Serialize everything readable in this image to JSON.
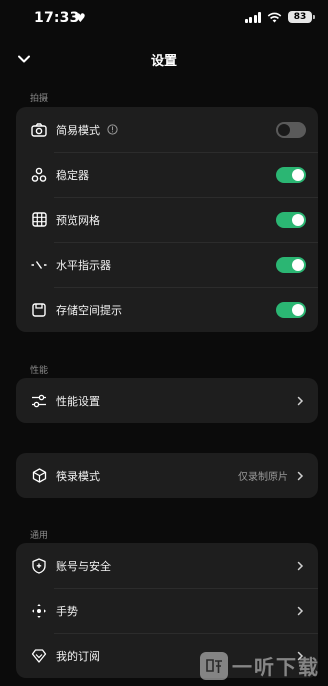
{
  "status_bar": {
    "time": "17:33",
    "heart_icon": "heart-icon",
    "battery": "83"
  },
  "nav": {
    "title": "设置",
    "back_icon": "chevron-down-icon"
  },
  "sections": {
    "shooting": {
      "label": "拍摄",
      "items": [
        {
          "label": "简易模式",
          "icon": "camera-icon",
          "info_icon": "info-icon",
          "toggle": "off"
        },
        {
          "label": "稳定器",
          "icon": "stabilizer-icon",
          "toggle": "on"
        },
        {
          "label": "预览网格",
          "icon": "grid-icon",
          "toggle": "on"
        },
        {
          "label": "水平指示器",
          "icon": "level-indicator-icon",
          "toggle": "on"
        },
        {
          "label": "存储空间提示",
          "icon": "storage-icon",
          "toggle": "on"
        }
      ]
    },
    "performance": {
      "label": "性能",
      "items": [
        {
          "label": "性能设置",
          "icon": "sliders-icon"
        }
      ]
    },
    "recording": {
      "items": [
        {
          "label": "筷录模式",
          "icon": "cube-icon",
          "value": "仅录制原片"
        }
      ]
    },
    "general": {
      "label": "通用",
      "items": [
        {
          "label": "账号与安全",
          "icon": "shield-icon"
        },
        {
          "label": "手势",
          "icon": "gesture-icon"
        },
        {
          "label": "我的订阅",
          "icon": "subscription-icon"
        }
      ]
    }
  },
  "watermark": {
    "text": "一听下载"
  },
  "colors": {
    "background": "#0b0b0b",
    "card": "#1e1e1e",
    "toggle_on": "#2bb673",
    "toggle_off": "#5a5a5a"
  }
}
